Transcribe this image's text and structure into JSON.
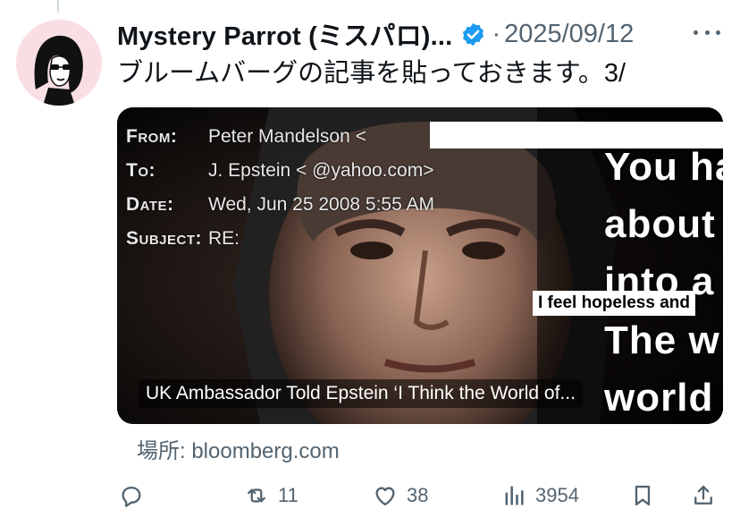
{
  "author": {
    "display_name": "Mystery Parrot (ミスパロ)...",
    "verified_icon": "verified-badge-icon",
    "separator": "·",
    "date": "2025/09/12"
  },
  "tweet": {
    "text": "ブルームバーグの記事を貼っておきます。3/"
  },
  "card": {
    "image_text": {
      "from_label": "From:",
      "from_value": "Peter Mandelson <",
      "to_label": "To:",
      "to_value": "J. Epstein <               @yahoo.com>",
      "date_label": "Date:",
      "date_value": "Wed, Jun 25 2008 5:55 AM",
      "subject_label": "Subject:",
      "subject_value": "RE:",
      "overlay_line1": "You ha",
      "overlay_line2": "about",
      "overlay_line3": "into a",
      "overlay_line4": "The w",
      "overlay_line5": "world",
      "quote": "I feel hopeless and"
    },
    "title": "UK Ambassador Told Epstein ‘I Think the World of..."
  },
  "source": {
    "text": "場所: bloomberg.com"
  },
  "actions": {
    "reply_icon": "reply-icon",
    "retweet_icon": "retweet-icon",
    "retweet_count": "11",
    "like_icon": "heart-icon",
    "like_count": "38",
    "views_icon": "views-chart-icon",
    "views_count": "3954",
    "bookmark_icon": "bookmark-icon",
    "share_icon": "share-icon"
  },
  "colors": {
    "text": "#0f1419",
    "secondary": "#536471",
    "verified": "#1d9bf0",
    "avatar_bg": "#f9dfe3"
  }
}
